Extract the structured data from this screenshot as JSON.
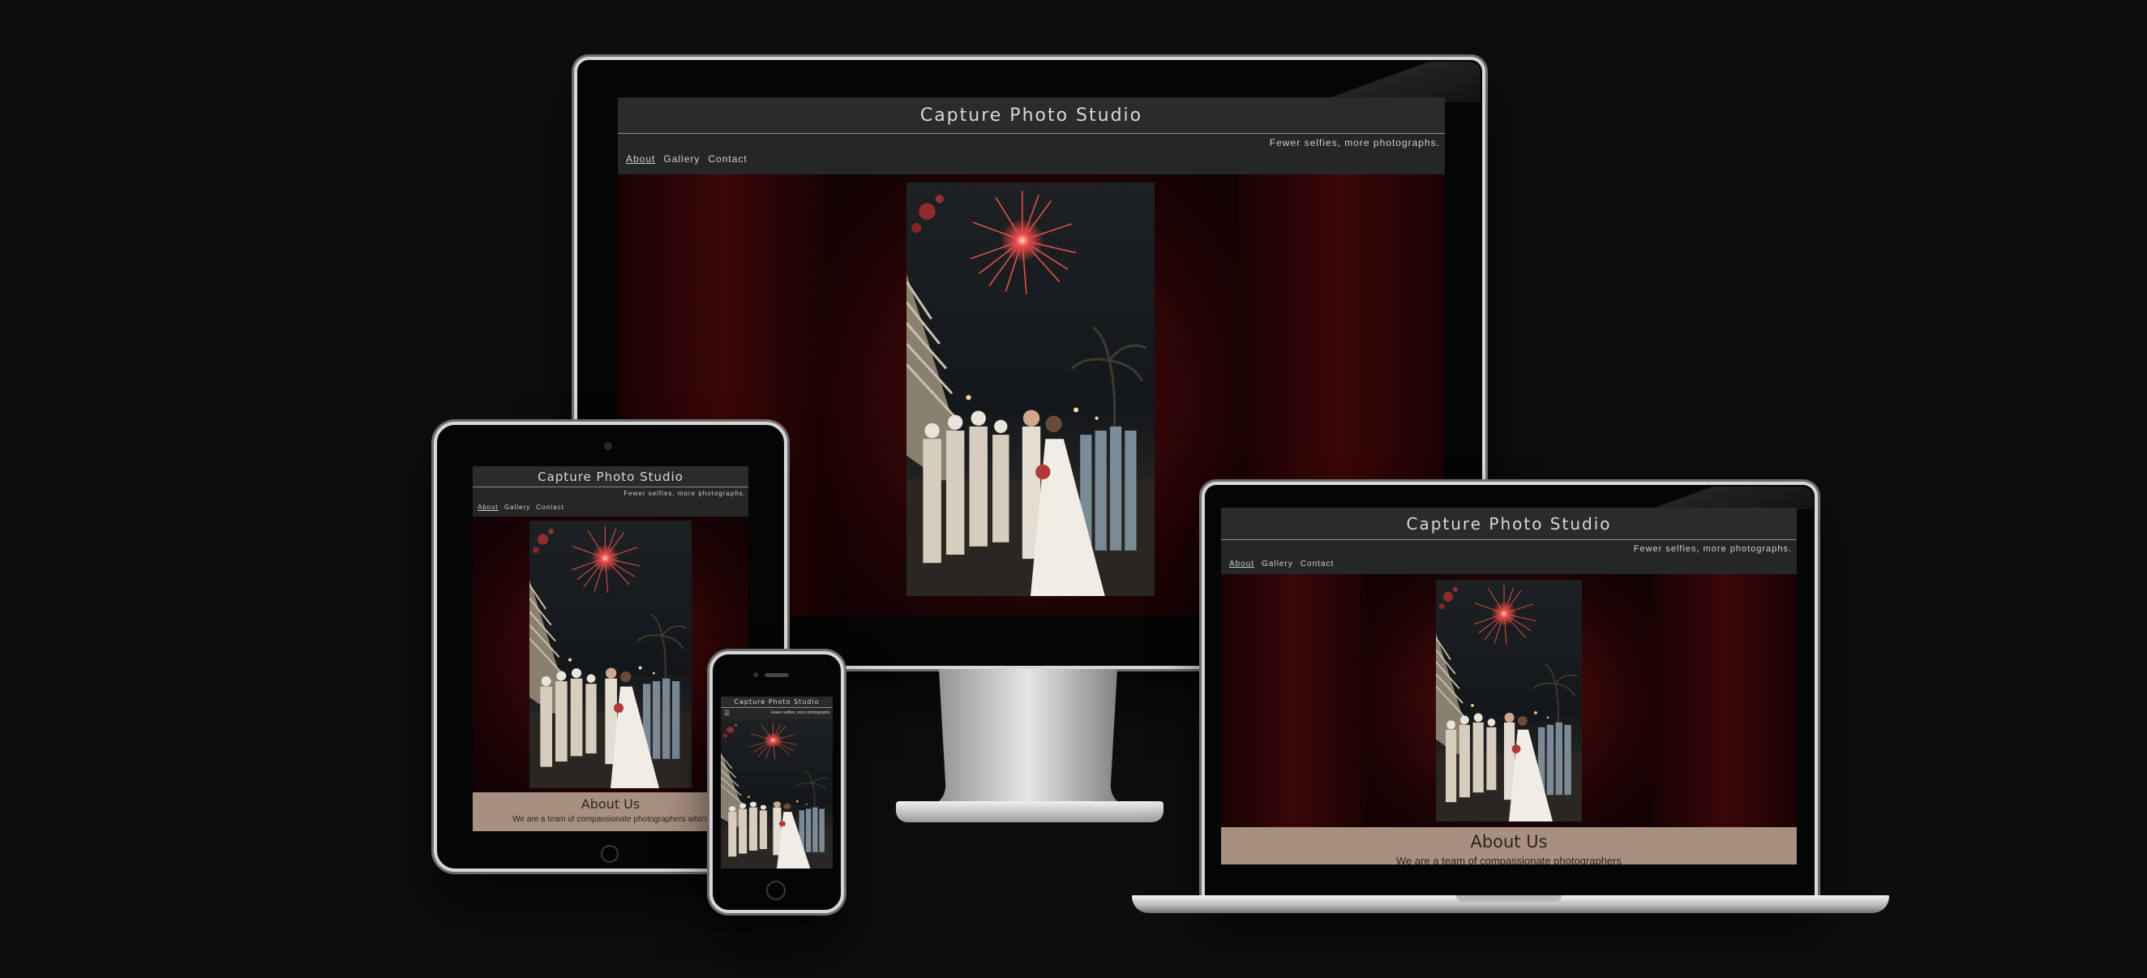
{
  "site": {
    "title": "Capture Photo Studio",
    "tagline": "Fewer selfies, more photographs.",
    "nav": [
      "About",
      "Gallery",
      "Contact"
    ],
    "about_heading": "About Us",
    "about_text": "We are a team of compassionate photographers who's",
    "about_text_short": "We are a team of compassionate photographers"
  },
  "colors": {
    "background": "#0e0c0d",
    "header": "#2a2b2c",
    "hero_red": "#5a0e0f",
    "about_bg": "#a89080"
  },
  "icons": {
    "hamburger": "hamburger-menu-icon"
  }
}
